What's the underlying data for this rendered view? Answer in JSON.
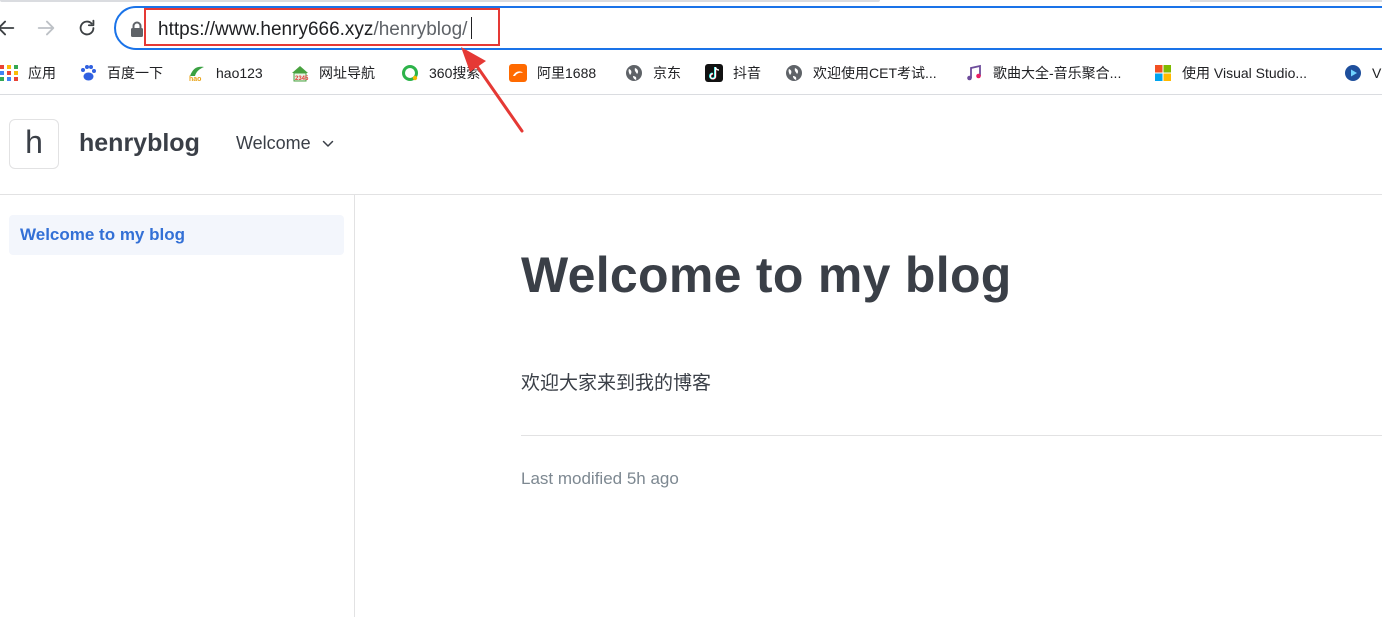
{
  "browser": {
    "url_host": "https://www.henry666.xyz",
    "url_path": "/henryblog/",
    "bookmarks": [
      {
        "label": "应用",
        "icon": "apps-grid-icon"
      },
      {
        "label": "百度一下",
        "icon": "baidu-paw-icon"
      },
      {
        "label": "hao123",
        "icon": "hao123-icon"
      },
      {
        "label": "网址导航",
        "icon": "2345-house-icon"
      },
      {
        "label": "360搜索",
        "icon": "360-search-icon"
      },
      {
        "label": "阿里1688",
        "icon": "alibaba-icon"
      },
      {
        "label": "京东",
        "icon": "globe-icon"
      },
      {
        "label": "抖音",
        "icon": "tiktok-icon"
      },
      {
        "label": "欢迎使用CET考试...",
        "icon": "globe-icon"
      },
      {
        "label": "歌曲大全-音乐聚合...",
        "icon": "music-note-icon"
      },
      {
        "label": "使用 Visual Studio...",
        "icon": "microsoft-logo-icon"
      },
      {
        "label": "V",
        "icon": "play-circle-icon"
      }
    ]
  },
  "site": {
    "logo_letter": "h",
    "title": "henryblog",
    "nav_label": "Welcome"
  },
  "sidebar": {
    "items": [
      {
        "label": "Welcome to my blog",
        "active": true
      }
    ]
  },
  "main": {
    "title": "Welcome to my blog",
    "body": "欢迎大家来到我的博客",
    "last_modified": "Last modified 5h ago"
  },
  "colors": {
    "accent": "#3370d6",
    "annotation": "#e53935",
    "omnibox_focus": "#1a73e8"
  }
}
